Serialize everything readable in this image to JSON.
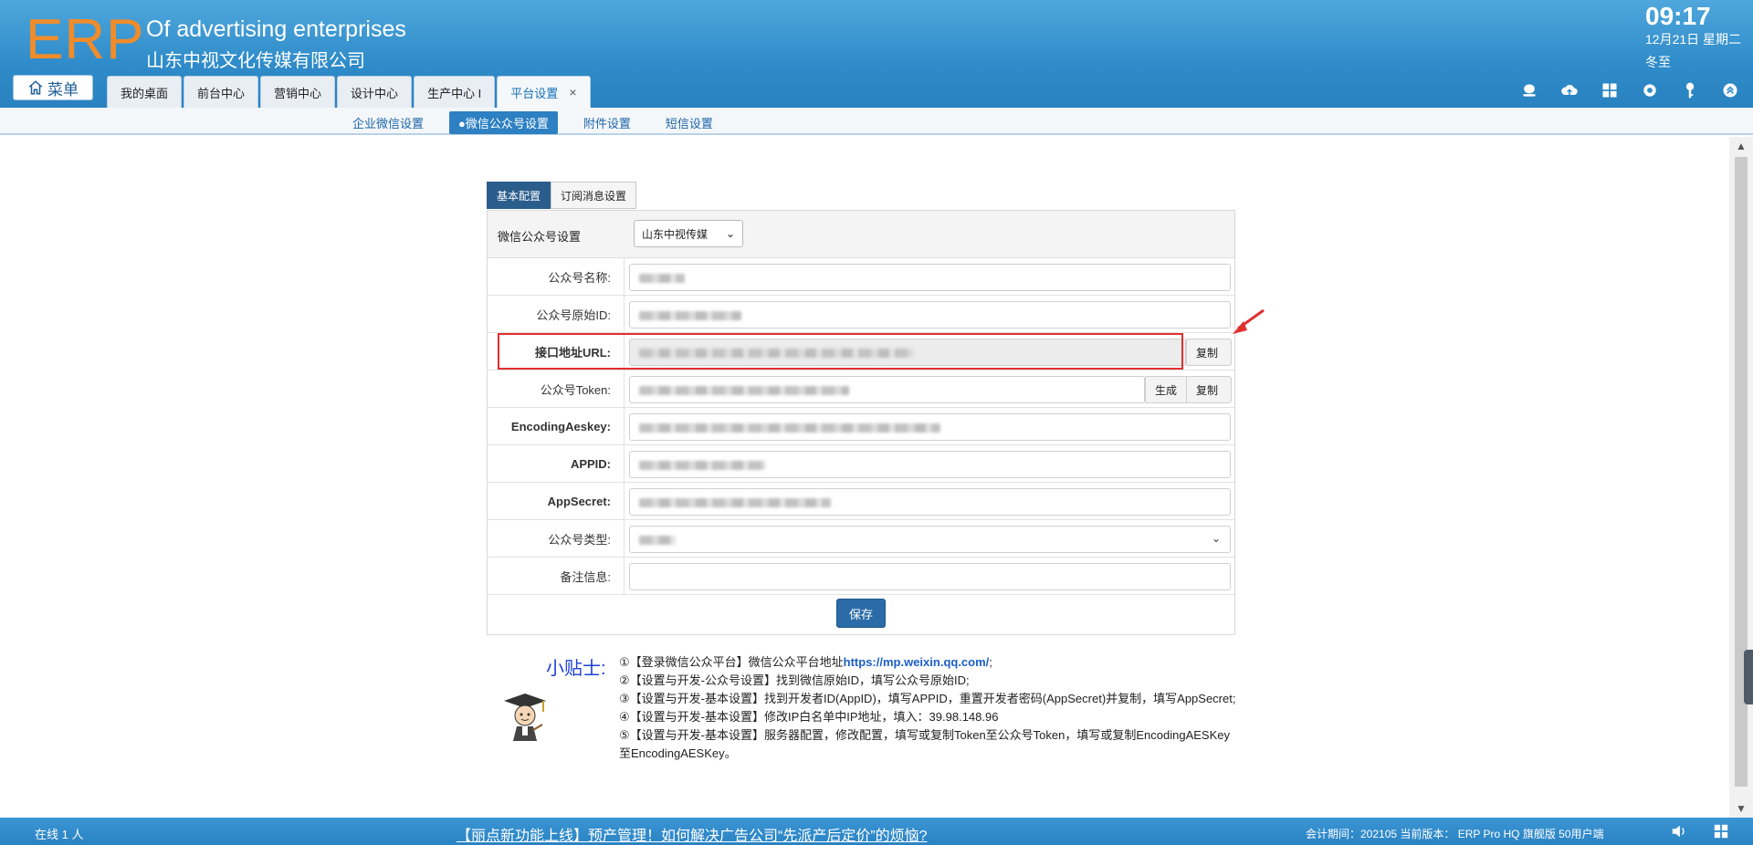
{
  "header": {
    "logo": "ERP",
    "company_en": "Of advertising enterprises",
    "company_cn": "山东中视文化传媒有限公司",
    "clock_time": "09:17",
    "clock_date": "12月21日 星期二",
    "clock_term": "冬至",
    "menu_label": "菜单"
  },
  "tabs": [
    {
      "label": "我的桌面"
    },
    {
      "label": "前台中心"
    },
    {
      "label": "营销中心"
    },
    {
      "label": "设计中心"
    },
    {
      "label": "生产中心 I"
    },
    {
      "label": "平台设置",
      "active": true
    }
  ],
  "subnav": [
    {
      "label": "企业微信设置"
    },
    {
      "label": "●微信公众号设置",
      "active": true
    },
    {
      "label": "附件设置"
    },
    {
      "label": "短信设置"
    }
  ],
  "panel": {
    "tabs": [
      "基本配置",
      "订阅消息设置"
    ],
    "head_label": "微信公众号设置",
    "account_select": "山东中视传媒",
    "fields": {
      "name": "公众号名称:",
      "original_id": "公众号原始ID:",
      "url": "接口地址URL:",
      "token": "公众号Token:",
      "aeskey": "EncodingAeskey:",
      "appid": "APPID:",
      "appsecret": "AppSecret:",
      "type": "公众号类型:",
      "remark": "备注信息:"
    },
    "buttons": {
      "copy": "复制",
      "generate": "生成",
      "save": "保存"
    }
  },
  "tips": {
    "title": "小贴士:",
    "line1_prefix": "①【登录微信公众平台】微信公众平台地址",
    "line1_link": "https://mp.weixin.qq.com/",
    "line1_suffix": ";",
    "line2": "②【设置与开发-公众号设置】找到微信原始ID，填写公众号原始ID;",
    "line3": "③【设置与开发-基本设置】找到开发者ID(AppID)，填写APPID，重置开发者密码(AppSecret)并复制，填写AppSecret;",
    "line4": "④【设置与开发-基本设置】修改IP白名单中IP地址，填入：39.98.148.96",
    "line5": "⑤【设置与开发-基本设置】服务器配置，修改配置，填写或复制Token至公众号Token，填写或复制EncodingAESKey至EncodingAESKey。"
  },
  "footer": {
    "online": "在线  1  人",
    "news": "【丽点新功能上线】预产管理！如何解决广告公司“先派产后定价”的烦恼?",
    "info": "会计期间：202105  当前版本：  ERP Pro HQ 旗舰版 50用户端"
  },
  "colors": {
    "header_blue": "#2f8bc9",
    "logo_orange": "#f08c2a",
    "annotation_red": "#e03030",
    "save_blue": "#2b6ca8"
  }
}
